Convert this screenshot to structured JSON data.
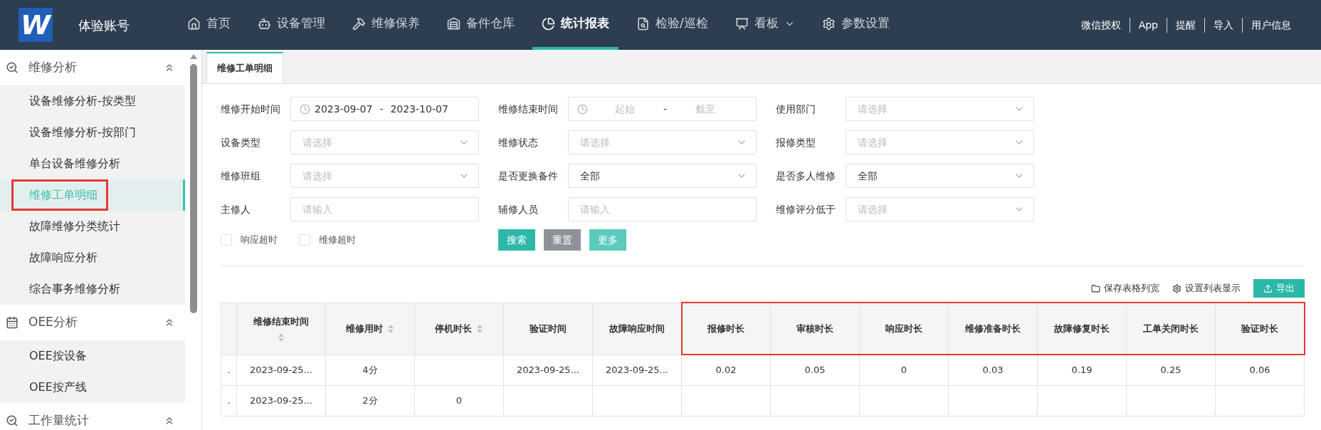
{
  "header": {
    "logo": "W",
    "account": "体验账号",
    "nav": [
      {
        "label": "首页",
        "selected": false,
        "dropdown": false
      },
      {
        "label": "设备管理",
        "selected": false,
        "dropdown": false
      },
      {
        "label": "维修保养",
        "selected": false,
        "dropdown": false
      },
      {
        "label": "备件仓库",
        "selected": false,
        "dropdown": false
      },
      {
        "label": "统计报表",
        "selected": true,
        "dropdown": false
      },
      {
        "label": "检验/巡检",
        "selected": false,
        "dropdown": false
      },
      {
        "label": "看板",
        "selected": false,
        "dropdown": true
      },
      {
        "label": "参数设置",
        "selected": false,
        "dropdown": false
      }
    ],
    "links": [
      "微信授权",
      "App",
      "提醒",
      "导入",
      "用户信息"
    ]
  },
  "sidebar": {
    "sections": [
      {
        "label": "维修分析",
        "expanded": true,
        "items": [
          {
            "label": "设备维修分析-按类型",
            "selected": false,
            "annotated": false
          },
          {
            "label": "设备维修分析-按部门",
            "selected": false,
            "annotated": false
          },
          {
            "label": "单台设备维修分析",
            "selected": false,
            "annotated": false
          },
          {
            "label": "维修工单明细",
            "selected": true,
            "annotated": true
          },
          {
            "label": "故障维修分类统计",
            "selected": false,
            "annotated": false
          },
          {
            "label": "故障响应分析",
            "selected": false,
            "annotated": false
          },
          {
            "label": "综合事务维修分析",
            "selected": false,
            "annotated": false
          }
        ]
      },
      {
        "label": "OEE分析",
        "expanded": true,
        "items": [
          {
            "label": "OEE按设备",
            "selected": false,
            "annotated": false
          },
          {
            "label": "OEE按产线",
            "selected": false,
            "annotated": false
          }
        ]
      },
      {
        "label": "工作量统计",
        "expanded": true
      }
    ]
  },
  "tabs": [
    {
      "label": "维修工单明细",
      "selected": true
    }
  ],
  "filters": [
    {
      "kind": "date_range",
      "label": "维修开始时间",
      "start": "2023-09-07",
      "separator": "-",
      "end": "2023-10-07"
    },
    {
      "kind": "date_range",
      "label": "维修结束时间",
      "start_placeholder": "起始",
      "separator": "-",
      "end_placeholder": "截至"
    },
    {
      "kind": "select",
      "label": "使用部门",
      "placeholder": "请选择"
    },
    {
      "kind": "select",
      "label": "设备类型",
      "placeholder": "请选择"
    },
    {
      "kind": "select",
      "label": "维修状态",
      "placeholder": "请选择"
    },
    {
      "kind": "select",
      "label": "报修类型",
      "placeholder": "请选择"
    },
    {
      "kind": "select",
      "label": "维修班组",
      "placeholder": "请选择"
    },
    {
      "kind": "select",
      "label": "是否更换备件",
      "value": "全部"
    },
    {
      "kind": "select",
      "label": "是否多人维修",
      "value": "全部"
    },
    {
      "kind": "input",
      "label": "主修人",
      "placeholder": "请输入"
    },
    {
      "kind": "input",
      "label": "辅修人员",
      "placeholder": "请输入"
    },
    {
      "kind": "select",
      "label": "维修评分低于",
      "placeholder": "请选择"
    }
  ],
  "checkboxes": [
    {
      "label": "响应超时",
      "checked": false
    },
    {
      "label": "维修超时",
      "checked": false
    }
  ],
  "buttons": [
    {
      "label": "搜索",
      "kind": "primary"
    },
    {
      "label": "重置",
      "kind": "secondary"
    },
    {
      "label": "更多",
      "kind": "light"
    }
  ],
  "toolbar": {
    "save_widths": "保存表格列宽",
    "column_settings": "设置列表显示",
    "export": "导出"
  },
  "table": {
    "columns": [
      {
        "annotated": false
      },
      {
        "label": "维修结束时间",
        "sortable": true,
        "annotated": false
      },
      {
        "label": "维修用时",
        "sortable": true,
        "annotated": false
      },
      {
        "label": "停机时长",
        "sortable": true,
        "annotated": false
      },
      {
        "label": "验证时间",
        "sortable": false,
        "annotated": false
      },
      {
        "label": "故障响应时间",
        "sortable": false,
        "annotated": false
      },
      {
        "label": "报修时长",
        "sortable": false,
        "annotated": true
      },
      {
        "label": "审核时长",
        "sortable": false,
        "annotated": true
      },
      {
        "label": "响应时长",
        "sortable": false,
        "annotated": true
      },
      {
        "label": "维修准备时长",
        "sortable": false,
        "annotated": true
      },
      {
        "label": "故障修复时长",
        "sortable": false,
        "annotated": true
      },
      {
        "label": "工单关闭时长",
        "sortable": false,
        "annotated": true
      },
      {
        "label": "验证时长",
        "sortable": false,
        "annotated": true
      }
    ],
    "rows": [
      [
        ".",
        "2023-09-25...",
        "4分",
        null,
        "2023-09-25...",
        "2023-09-25...",
        "0.02",
        "0.05",
        "0",
        "0.03",
        "0.19",
        "0.25",
        "0.06"
      ],
      [
        ".",
        "2023-09-25...",
        "2分",
        "0",
        null,
        null,
        null,
        null,
        null,
        null,
        null,
        null,
        null
      ]
    ]
  }
}
